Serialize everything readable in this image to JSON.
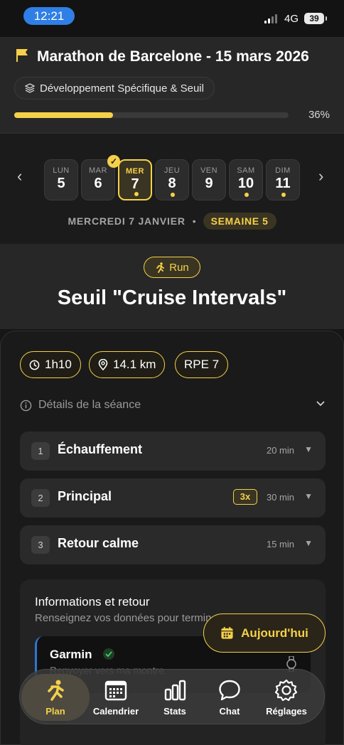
{
  "status_bar": {
    "time": "12:21",
    "network": "4G",
    "battery": "39"
  },
  "header": {
    "goal_title": "Marathon de Barcelone - 15 mars 2026",
    "phase": "Développement Spécifique & Seuil",
    "progress_percent": 36,
    "progress_label": "36%"
  },
  "week": {
    "prev_label": "‹",
    "next_label": "›",
    "days": [
      {
        "name": "LUN",
        "num": "5",
        "dot": false,
        "selected": false
      },
      {
        "name": "MAR",
        "num": "6",
        "dot": false,
        "selected": false
      },
      {
        "name": "MER",
        "num": "7",
        "dot": true,
        "selected": true
      },
      {
        "name": "JEU",
        "num": "8",
        "dot": true,
        "selected": false
      },
      {
        "name": "VEN",
        "num": "9",
        "dot": false,
        "selected": false
      },
      {
        "name": "SAM",
        "num": "10",
        "dot": true,
        "selected": false
      },
      {
        "name": "DIM",
        "num": "11",
        "dot": true,
        "selected": false
      }
    ],
    "selected_date": "MERCREDI 7 JANVIER",
    "separator": "•",
    "week_badge": "SEMAINE 5"
  },
  "session": {
    "type_label": "Run",
    "title": "Seuil \"Cruise Intervals\""
  },
  "stats": {
    "duration": "1h10",
    "distance": "14.1 km",
    "rpe": "RPE 7"
  },
  "details": {
    "label": "Détails de la séance"
  },
  "steps": [
    {
      "index": "1",
      "name": "Échauffement",
      "duration": "20 min",
      "reps": ""
    },
    {
      "index": "2",
      "name": "Principal",
      "duration": "30 min",
      "reps": "3x"
    },
    {
      "index": "3",
      "name": "Retour calme",
      "duration": "15 min",
      "reps": ""
    }
  ],
  "info": {
    "title": "Informations et retour",
    "subtitle": "Renseignez vos données pour terminer",
    "garmin_name": "Garmin",
    "garmin_action": "Renvoyer vers ma montre"
  },
  "today_button": "Aujourd'hui",
  "tabs": [
    {
      "label": "Plan",
      "icon": "run-icon",
      "active": true
    },
    {
      "label": "Calendrier",
      "icon": "calendar-icon",
      "active": false
    },
    {
      "label": "Stats",
      "icon": "stats-icon",
      "active": false
    },
    {
      "label": "Chat",
      "icon": "chat-icon",
      "active": false
    },
    {
      "label": "Réglages",
      "icon": "settings-icon",
      "active": false
    }
  ],
  "colors": {
    "accent": "#f5d14a",
    "background": "#161616",
    "card": "#2a2a2a",
    "status_pill": "#2f7fe6"
  }
}
